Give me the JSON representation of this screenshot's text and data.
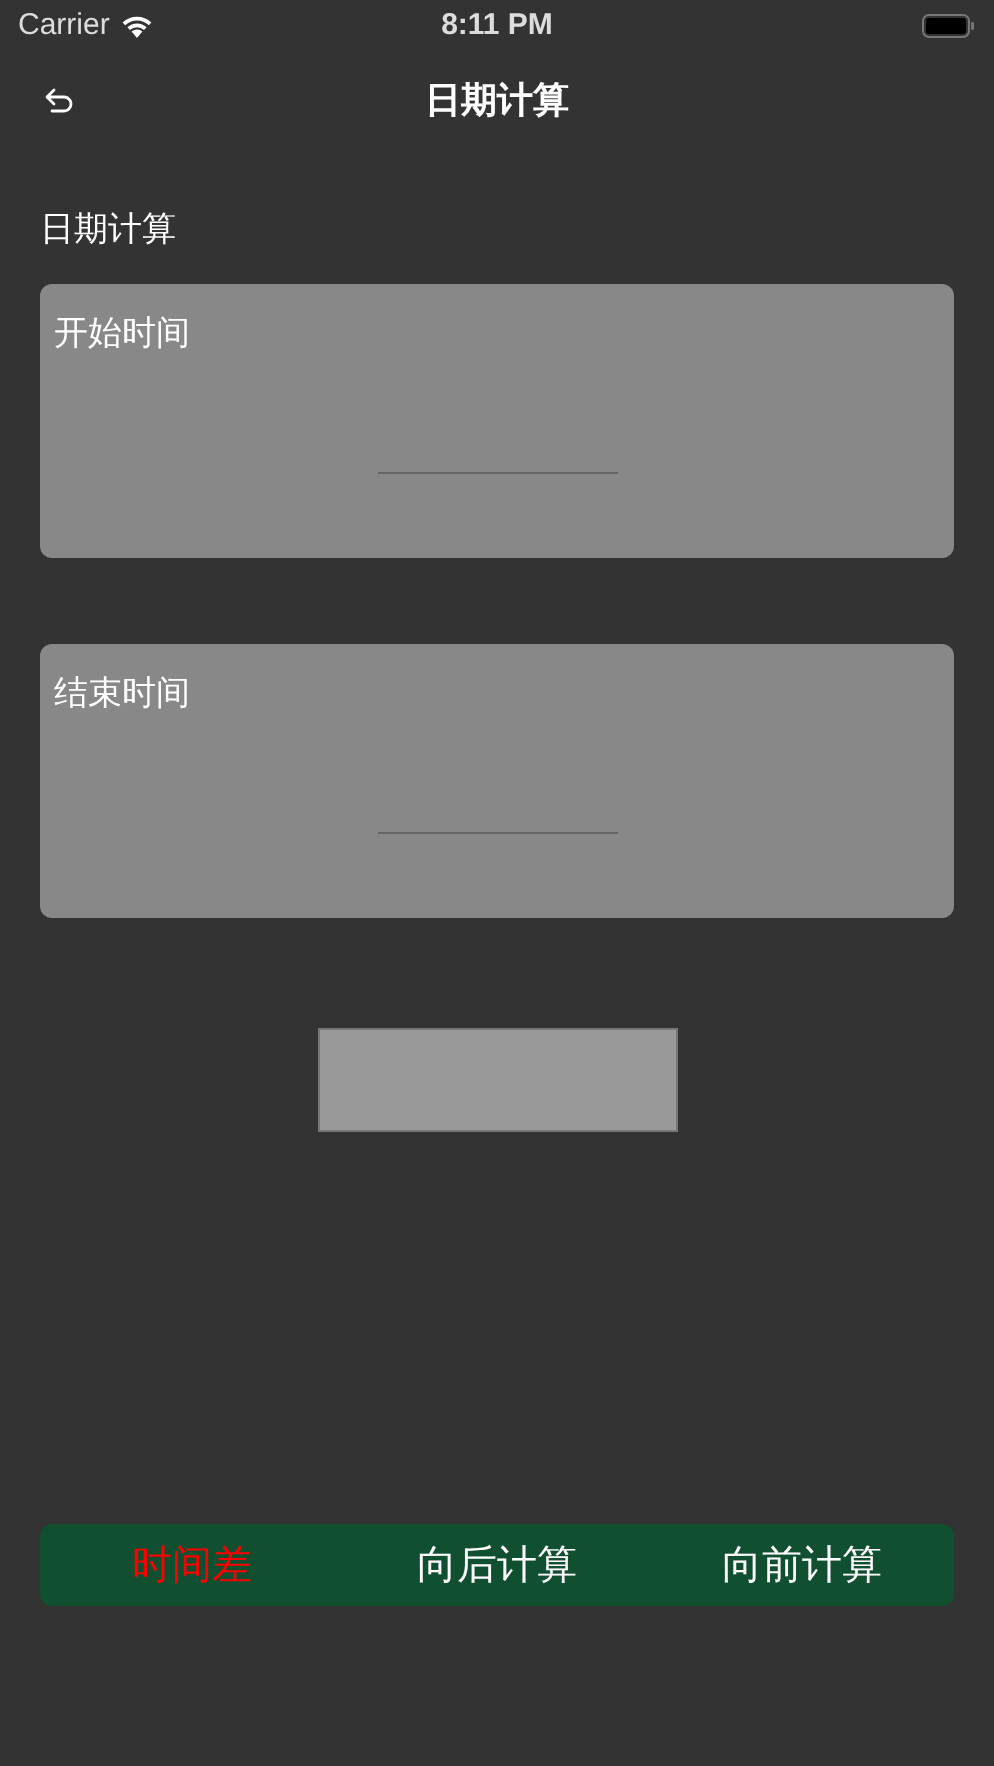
{
  "status_bar": {
    "carrier": "Carrier",
    "time": "8:11 PM"
  },
  "nav": {
    "title": "日期计算"
  },
  "section_title": "日期计算",
  "fields": [
    {
      "label": "开始时间"
    },
    {
      "label": "结束时间"
    }
  ],
  "tabs": [
    {
      "label": "时间差",
      "selected": true
    },
    {
      "label": "向后计算",
      "selected": false
    },
    {
      "label": "向前计算",
      "selected": false
    }
  ]
}
